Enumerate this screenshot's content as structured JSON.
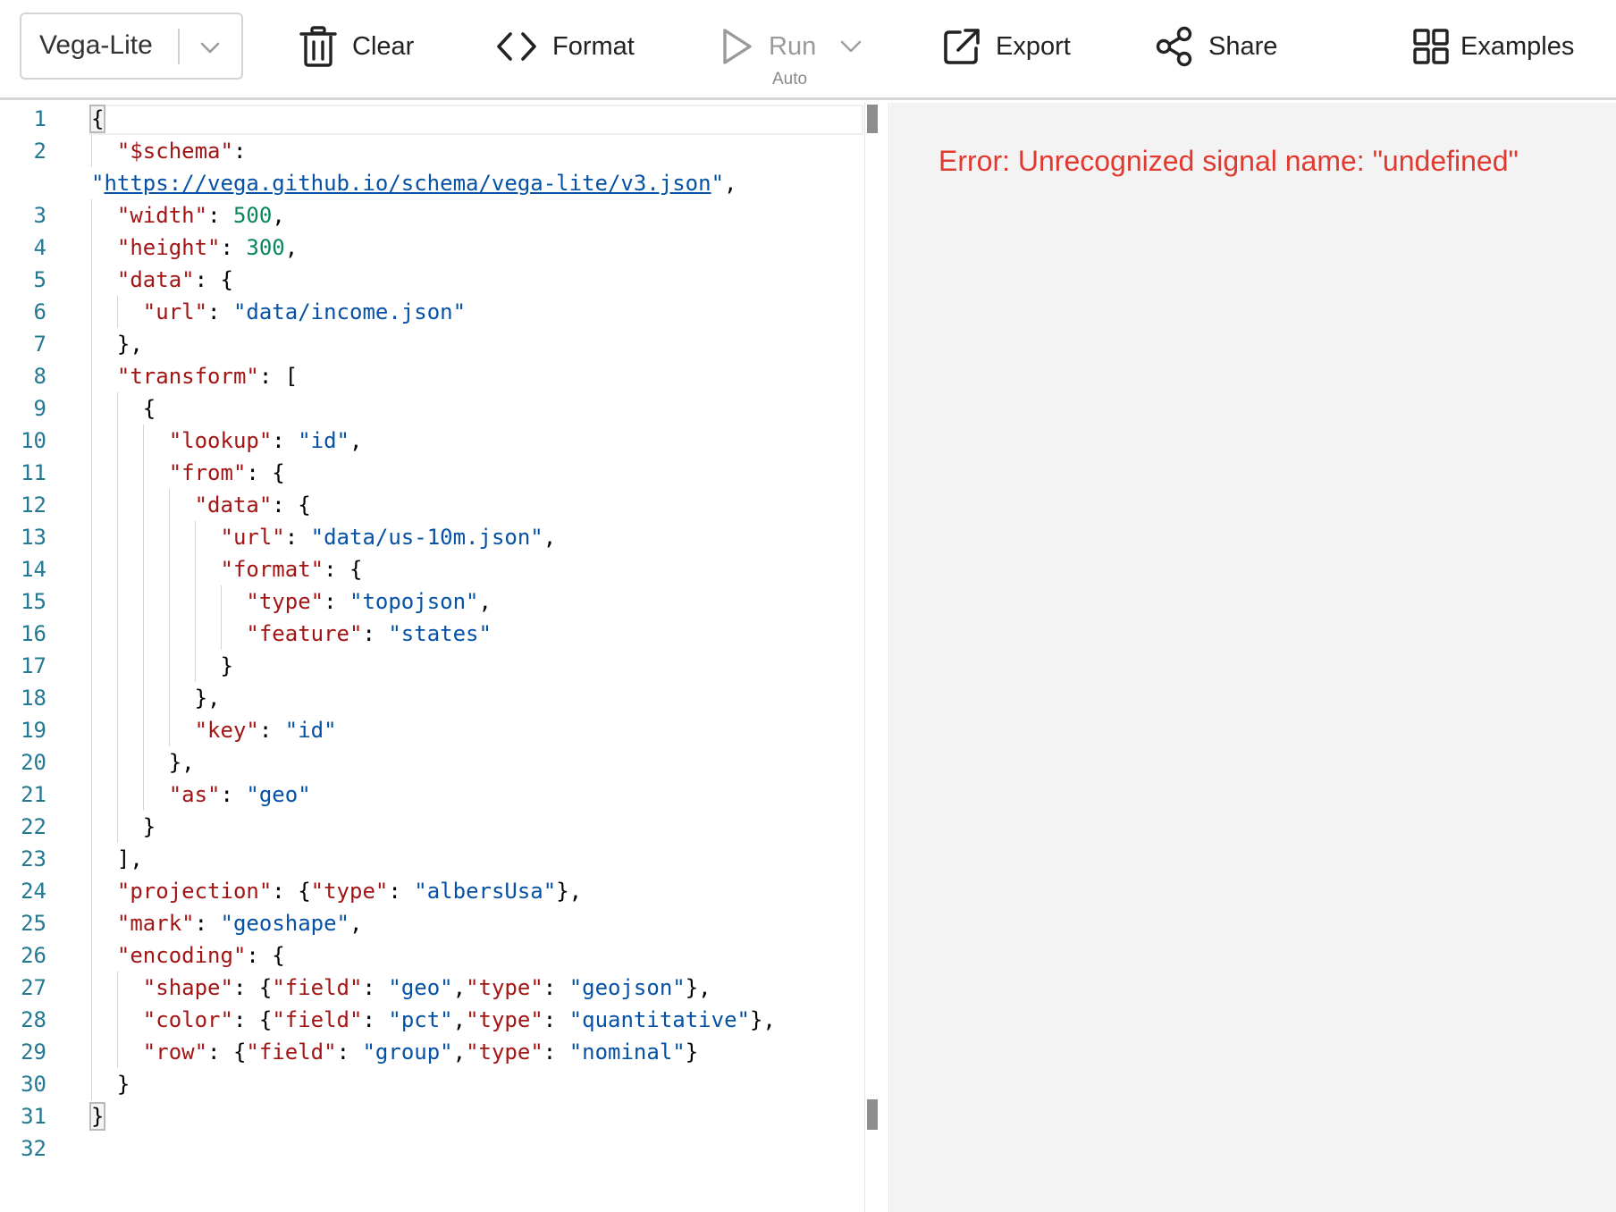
{
  "toolbar": {
    "mode": "Vega-Lite",
    "clear": "Clear",
    "format": "Format",
    "run": "Run",
    "run_sub": "Auto",
    "export": "Export",
    "share": "Share",
    "examples": "Examples"
  },
  "editor": {
    "lines": [
      {
        "n": "1",
        "tokens": [
          [
            "p",
            "{"
          ]
        ]
      },
      {
        "n": "2",
        "tokens": [
          [
            "p",
            "  "
          ],
          [
            "k",
            "\"$schema\""
          ],
          [
            "p",
            ":"
          ]
        ]
      },
      {
        "n": "",
        "tokens": [
          [
            "s",
            "\""
          ],
          [
            "u",
            "https://vega.github.io/schema/vega-lite/v3.json"
          ],
          [
            "s",
            "\""
          ],
          [
            "p",
            ","
          ]
        ]
      },
      {
        "n": "3",
        "tokens": [
          [
            "p",
            "  "
          ],
          [
            "k",
            "\"width\""
          ],
          [
            "p",
            ": "
          ],
          [
            "n",
            "500"
          ],
          [
            "p",
            ","
          ]
        ]
      },
      {
        "n": "4",
        "tokens": [
          [
            "p",
            "  "
          ],
          [
            "k",
            "\"height\""
          ],
          [
            "p",
            ": "
          ],
          [
            "n",
            "300"
          ],
          [
            "p",
            ","
          ]
        ]
      },
      {
        "n": "5",
        "tokens": [
          [
            "p",
            "  "
          ],
          [
            "k",
            "\"data\""
          ],
          [
            "p",
            ": {"
          ]
        ]
      },
      {
        "n": "6",
        "tokens": [
          [
            "p",
            "    "
          ],
          [
            "k",
            "\"url\""
          ],
          [
            "p",
            ": "
          ],
          [
            "s",
            "\"data/income.json\""
          ]
        ]
      },
      {
        "n": "7",
        "tokens": [
          [
            "p",
            "  },"
          ]
        ]
      },
      {
        "n": "8",
        "tokens": [
          [
            "p",
            "  "
          ],
          [
            "k",
            "\"transform\""
          ],
          [
            "p",
            ": ["
          ]
        ]
      },
      {
        "n": "9",
        "tokens": [
          [
            "p",
            "    {"
          ]
        ]
      },
      {
        "n": "10",
        "tokens": [
          [
            "p",
            "      "
          ],
          [
            "k",
            "\"lookup\""
          ],
          [
            "p",
            ": "
          ],
          [
            "s",
            "\"id\""
          ],
          [
            "p",
            ","
          ]
        ]
      },
      {
        "n": "11",
        "tokens": [
          [
            "p",
            "      "
          ],
          [
            "k",
            "\"from\""
          ],
          [
            "p",
            ": {"
          ]
        ]
      },
      {
        "n": "12",
        "tokens": [
          [
            "p",
            "        "
          ],
          [
            "k",
            "\"data\""
          ],
          [
            "p",
            ": {"
          ]
        ]
      },
      {
        "n": "13",
        "tokens": [
          [
            "p",
            "          "
          ],
          [
            "k",
            "\"url\""
          ],
          [
            "p",
            ": "
          ],
          [
            "s",
            "\"data/us-10m.json\""
          ],
          [
            "p",
            ","
          ]
        ]
      },
      {
        "n": "14",
        "tokens": [
          [
            "p",
            "          "
          ],
          [
            "k",
            "\"format\""
          ],
          [
            "p",
            ": {"
          ]
        ]
      },
      {
        "n": "15",
        "tokens": [
          [
            "p",
            "            "
          ],
          [
            "k",
            "\"type\""
          ],
          [
            "p",
            ": "
          ],
          [
            "s",
            "\"topojson\""
          ],
          [
            "p",
            ","
          ]
        ]
      },
      {
        "n": "16",
        "tokens": [
          [
            "p",
            "            "
          ],
          [
            "k",
            "\"feature\""
          ],
          [
            "p",
            ": "
          ],
          [
            "s",
            "\"states\""
          ]
        ]
      },
      {
        "n": "17",
        "tokens": [
          [
            "p",
            "          }"
          ]
        ]
      },
      {
        "n": "18",
        "tokens": [
          [
            "p",
            "        },"
          ]
        ]
      },
      {
        "n": "19",
        "tokens": [
          [
            "p",
            "        "
          ],
          [
            "k",
            "\"key\""
          ],
          [
            "p",
            ": "
          ],
          [
            "s",
            "\"id\""
          ]
        ]
      },
      {
        "n": "20",
        "tokens": [
          [
            "p",
            "      },"
          ]
        ]
      },
      {
        "n": "21",
        "tokens": [
          [
            "p",
            "      "
          ],
          [
            "k",
            "\"as\""
          ],
          [
            "p",
            ": "
          ],
          [
            "s",
            "\"geo\""
          ]
        ]
      },
      {
        "n": "22",
        "tokens": [
          [
            "p",
            "    }"
          ]
        ]
      },
      {
        "n": "23",
        "tokens": [
          [
            "p",
            "  ],"
          ]
        ]
      },
      {
        "n": "24",
        "tokens": [
          [
            "p",
            "  "
          ],
          [
            "k",
            "\"projection\""
          ],
          [
            "p",
            ": {"
          ],
          [
            "k",
            "\"type\""
          ],
          [
            "p",
            ": "
          ],
          [
            "s",
            "\"albersUsa\""
          ],
          [
            "p",
            "},"
          ]
        ]
      },
      {
        "n": "25",
        "tokens": [
          [
            "p",
            "  "
          ],
          [
            "k",
            "\"mark\""
          ],
          [
            "p",
            ": "
          ],
          [
            "s",
            "\"geoshape\""
          ],
          [
            "p",
            ","
          ]
        ]
      },
      {
        "n": "26",
        "tokens": [
          [
            "p",
            "  "
          ],
          [
            "k",
            "\"encoding\""
          ],
          [
            "p",
            ": {"
          ]
        ]
      },
      {
        "n": "27",
        "tokens": [
          [
            "p",
            "    "
          ],
          [
            "k",
            "\"shape\""
          ],
          [
            "p",
            ": {"
          ],
          [
            "k",
            "\"field\""
          ],
          [
            "p",
            ": "
          ],
          [
            "s",
            "\"geo\""
          ],
          [
            "p",
            ","
          ],
          [
            "k",
            "\"type\""
          ],
          [
            "p",
            ": "
          ],
          [
            "s",
            "\"geojson\""
          ],
          [
            "p",
            "},"
          ]
        ]
      },
      {
        "n": "28",
        "tokens": [
          [
            "p",
            "    "
          ],
          [
            "k",
            "\"color\""
          ],
          [
            "p",
            ": {"
          ],
          [
            "k",
            "\"field\""
          ],
          [
            "p",
            ": "
          ],
          [
            "s",
            "\"pct\""
          ],
          [
            "p",
            ","
          ],
          [
            "k",
            "\"type\""
          ],
          [
            "p",
            ": "
          ],
          [
            "s",
            "\"quantitative\""
          ],
          [
            "p",
            "},"
          ]
        ]
      },
      {
        "n": "29",
        "tokens": [
          [
            "p",
            "    "
          ],
          [
            "k",
            "\"row\""
          ],
          [
            "p",
            ": {"
          ],
          [
            "k",
            "\"field\""
          ],
          [
            "p",
            ": "
          ],
          [
            "s",
            "\"group\""
          ],
          [
            "p",
            ","
          ],
          [
            "k",
            "\"type\""
          ],
          [
            "p",
            ": "
          ],
          [
            "s",
            "\"nominal\""
          ],
          [
            "p",
            "}"
          ]
        ]
      },
      {
        "n": "30",
        "tokens": [
          [
            "p",
            "  }"
          ]
        ]
      },
      {
        "n": "31",
        "tokens": [
          [
            "p",
            "}"
          ]
        ]
      },
      {
        "n": "32",
        "tokens": []
      }
    ]
  },
  "preview": {
    "error": "Error: Unrecognized signal name: \"undefined\""
  },
  "colors": {
    "key": "#a31515",
    "string": "#0451a5",
    "number": "#098658",
    "error": "#e03a30",
    "line_number": "#237893"
  }
}
